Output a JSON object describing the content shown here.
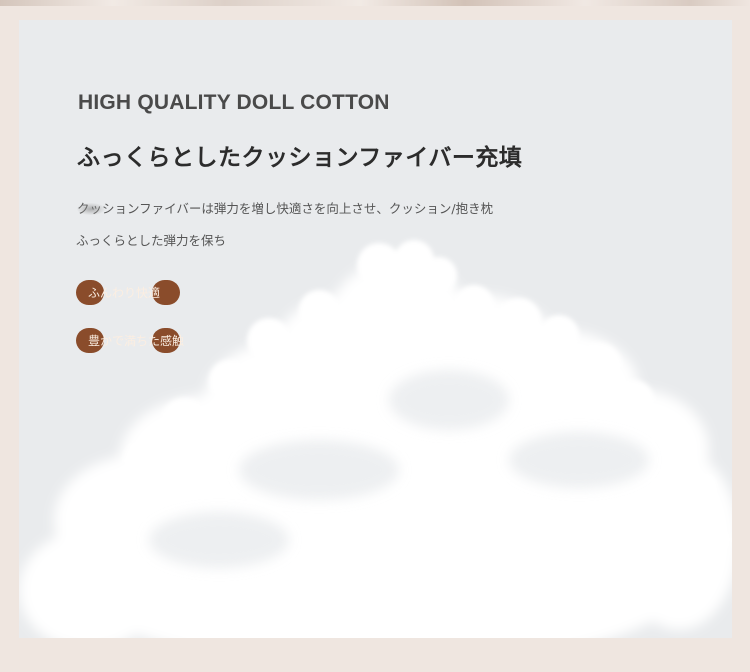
{
  "heading": {
    "english": "HIGH QUALITY DOLL COTTON",
    "japanese": "ふっくらとしたクッションファイバー充填"
  },
  "description": {
    "line1": "クッションファイバーは弾力を増し快適さを向上させ、クッション/抱き枕",
    "line2": "ふっくらとした弾力を保ち"
  },
  "features": [
    {
      "label": "ふんわり快適"
    },
    {
      "label": "豊かで満ちた感触"
    }
  ],
  "colors": {
    "page_background": "#efe6e0",
    "card_background": "#e8eaec",
    "pill_color": "#8a4c2b",
    "pill_text": "#fbeee2"
  },
  "image": {
    "subject": "cotton-fiber-cloud-image"
  }
}
